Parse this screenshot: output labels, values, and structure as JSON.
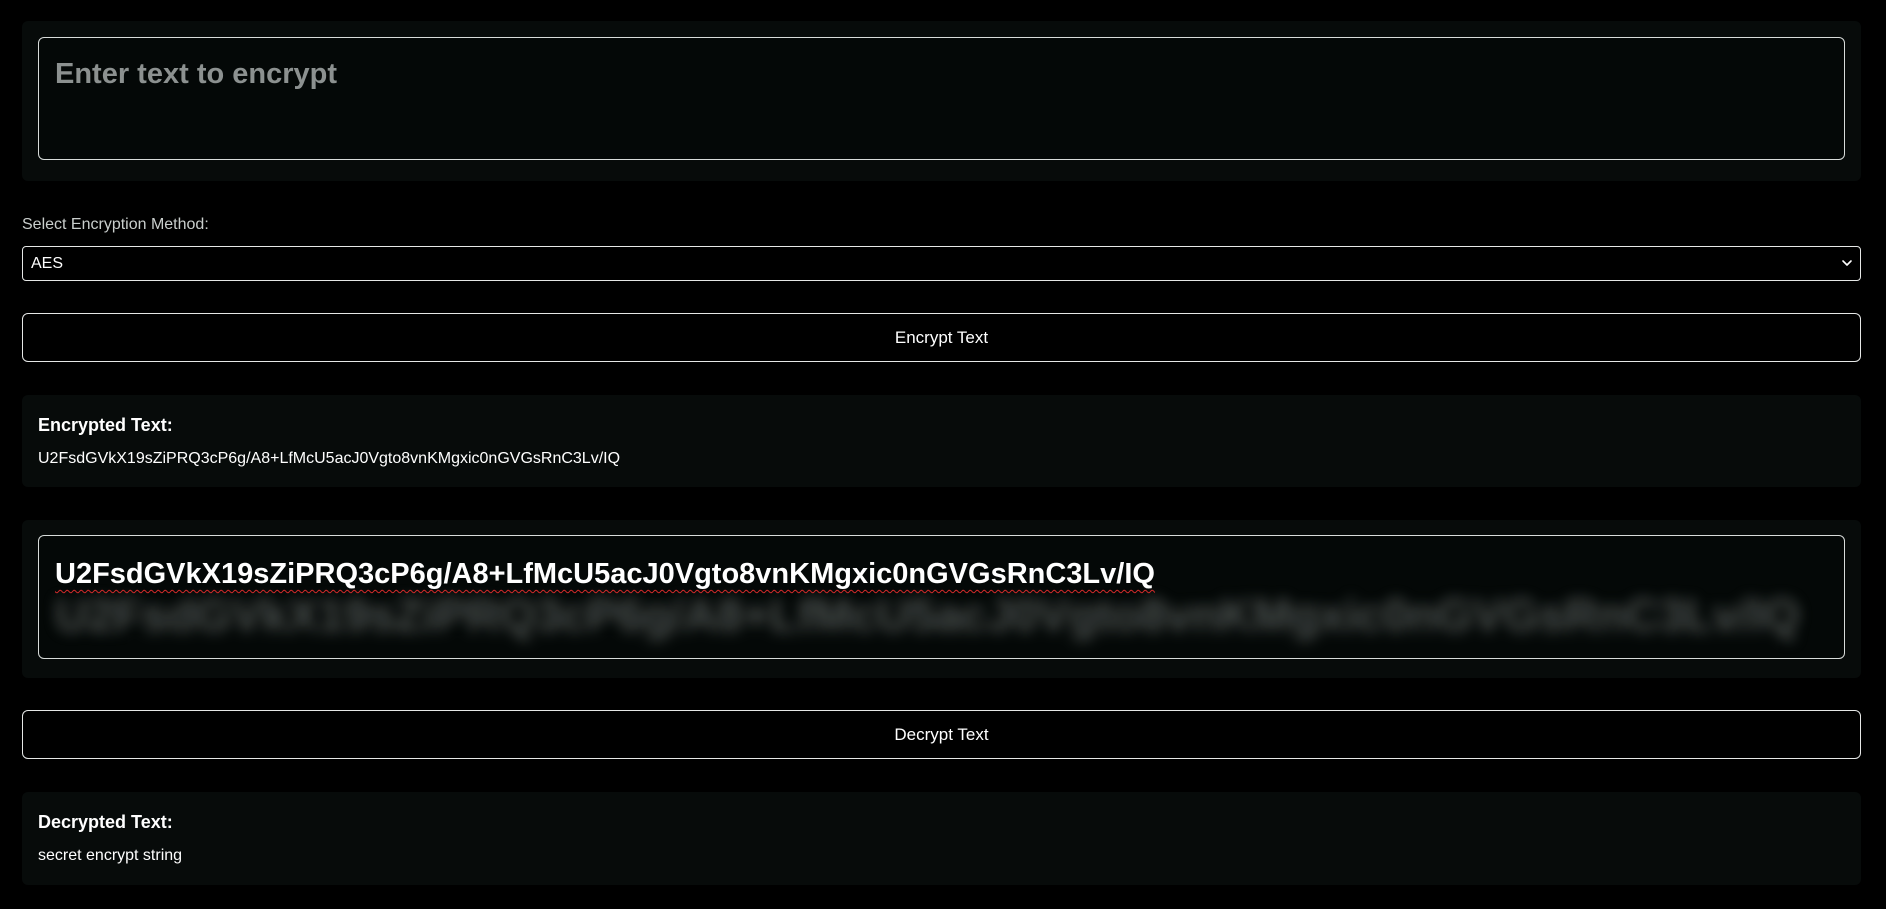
{
  "input": {
    "placeholder": "Enter text to encrypt"
  },
  "method": {
    "label": "Select Encryption Method:",
    "selected": "AES"
  },
  "encrypt_button": {
    "label": "Encrypt Text"
  },
  "encrypted": {
    "heading": "Encrypted Text:",
    "value": "U2FsdGVkX19sZiPRQ3cP6g/A8+LfMcU5acJ0Vgto8vnKMgxic0nGVGsRnC3Lv/IQ"
  },
  "cipher_input": {
    "value": "U2FsdGVkX19sZiPRQ3cP6g/A8+LfMcU5acJ0Vgto8vnKMgxic0nGVGsRnC3Lv/IQ"
  },
  "decrypt_button": {
    "label": "Decrypt Text"
  },
  "decrypted": {
    "heading": "Decrypted Text:",
    "value": "secret encrypt string"
  },
  "colors": {
    "background": "#000000",
    "panel": "#070b0a",
    "border": "#d8dcda",
    "placeholder": "#8c9190",
    "spellcheck_underline": "#d62b2b"
  }
}
